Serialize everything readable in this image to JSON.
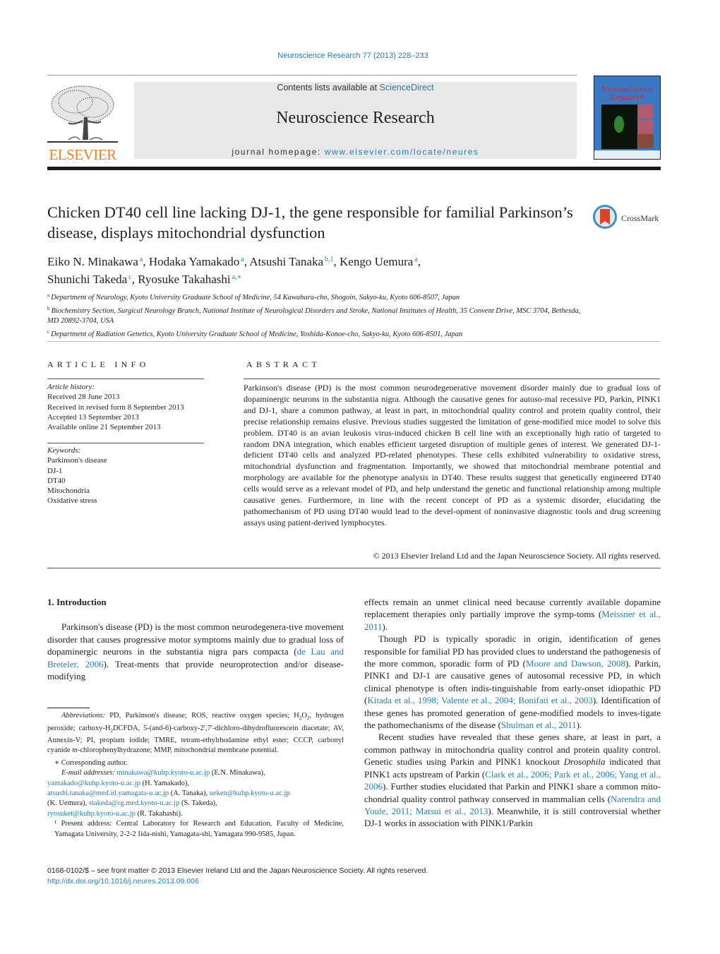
{
  "header": {
    "journal_reference": "Neuroscience Research 77 (2013) 228–233",
    "publisher_logo_text": "ELSEVIER",
    "contents_prefix": "Contents lists available at ",
    "contents_link": "ScienceDirect",
    "journal_name": "Neuroscience Research",
    "homepage_prefix": "journal homepage: ",
    "homepage_link": "www.elsevier.com/locate/neures",
    "cover_title_line1": "Neuroscience",
    "cover_title_line2": "Research",
    "crossmark_label": "CrossMark"
  },
  "article": {
    "title": "Chicken DT40 cell line lacking DJ-1, the gene responsible for familial Parkinson’s disease, displays mitochondrial dysfunction",
    "authors": [
      {
        "name": "Eiko N. Minakawa",
        "marks": "a",
        "sep": ", "
      },
      {
        "name": "Hodaka Yamakado",
        "marks": "a",
        "sep": ", "
      },
      {
        "name": "Atsushi Tanaka",
        "marks": "b,1",
        "sep": ", "
      },
      {
        "name": "Kengo Uemura",
        "marks": "a",
        "sep": ","
      },
      {
        "name": "Shunichi Takeda",
        "marks": "c",
        "sep": ", "
      },
      {
        "name": "Ryosuke Takahashi",
        "marks": "a,∗",
        "sep": ""
      }
    ],
    "affiliations": [
      {
        "mark": "a",
        "text": "Department of Neurology, Kyoto University Graduate School of Medicine, 54 Kawahara-cho, Shogoin, Sakyo-ku, Kyoto 606-8507, Japan"
      },
      {
        "mark": "b",
        "text": "Biochemistry Section, Surgical Neurology Branch, National Institute of Neurological Disorders and Stroke, National Institutes of Health, 35 Convent Drive, MSC 3704, Bethesda, MD 20892-3704, USA"
      },
      {
        "mark": "c",
        "text": "Department of Radiation Genetics, Kyoto University Graduate School of Medicine, Yoshida-Konoe-cho, Sakyo-ku, Kyoto 606-8501, Japan"
      }
    ]
  },
  "article_info": {
    "heading": "ARTICLE INFO",
    "history_label": "Article history:",
    "history": [
      "Received 28 June 2013",
      "Received in revised form 8 September 2013",
      "Accepted 13 September 2013",
      "Available online 21 September 2013"
    ],
    "keywords_label": "Keywords:",
    "keywords": [
      "Parkinson's disease",
      "DJ-1",
      "DT40",
      "Mitochondria",
      "Oxidative stress"
    ]
  },
  "abstract": {
    "heading": "ABSTRACT",
    "text": "Parkinson's disease (PD) is the most common neurodegenerative movement disorder mainly due to gradual loss of dopaminergic neurons in the substantia nigra. Although the causative genes for autoso-mal recessive PD, Parkin, PINK1 and DJ-1, share a common pathway, at least in part, in mitochondrial quality control and protein quality control, their precise relationship remains elusive. Previous studies suggested the limitation of gene-modified mice model to solve this problem. DT40 is an avian leukosis virus-induced chicken B cell line with an exceptionally high ratio of targeted to random DNA integration, which enables efficient targeted disruption of multiple genes of interest. We generated DJ-1-deficient DT40 cells and analyzed PD-related phenotypes. These cells exhibited vulnerability to oxidative stress, mitochondrial dysfunction and fragmentation. Importantly, we showed that mitochondrial membrane potential and morphology are available for the phenotype analysis in DT40. These results suggest that genetically engineered DT40 cells would serve as a relevant model of PD, and help understand the genetic and functional relationship among multiple causative genes. Furthermore, in line with the recent concept of PD as a systemic disorder, elucidating the pathomechanism of PD using DT40 would lead to the devel-opment of noninvasive diagnostic tools and drug screening assays using patient-derived lymphocytes.",
    "copyright": "© 2013 Elsevier Ireland Ltd and the Japan Neuroscience Society. All rights reserved."
  },
  "introduction": {
    "heading": "1.  Introduction",
    "p1_a": "Parkinson's disease (PD) is the most common neurodegenera-tive movement disorder that causes progressive motor symptoms mainly due to gradual loss of dopaminergic neurons in the substantia nigra pars compacta (",
    "p1_cite": "de Lau and Breteler, 2006",
    "p1_b": "). Treat-ments that provide neuroprotection and/or disease-modifying",
    "r1_a": "effects remain an unmet clinical need because currently available dopamine replacement therapies only partially improve the symp-toms (",
    "r1_cite": "Meissner et al., 2011",
    "r1_b": ").",
    "r2_a": "Though PD is typically sporadic in origin, identification of genes responsible for familial PD has provided clues to understand the pathogenesis of the more common, sporadic form of PD (",
    "r2_cite1": "Moore and Dawson, 2008",
    "r2_b": "). Parkin, PINK1 and DJ-1 are causative genes of autosomal recessive PD, in which clinical phenotype is often indis-tinguishable from early-onset idiopathic PD (",
    "r2_cite2": "Kitada et al., 1998; Valente et al., 2004; Bonifati et al., 2003",
    "r2_c": "). Identification of these genes has promoted generation of gene-modified models to inves-tigate the pathomechanisms of the disease (",
    "r2_cite3": "Shulman et al., 2011",
    "r2_d": ").",
    "r3_a": "Recent studies have revealed that these genes share, at least in part, a common pathway in mitochondria quality control and protein quality control. Genetic studies using Parkin and PINK1 knockout ",
    "r3_italic": "Drosophila",
    "r3_b": " indicated that PINK1 acts upstream of Parkin (",
    "r3_cite1": "Clark et al., 2006; Park et al., 2006; Yang et al., 2006",
    "r3_c": "). Further studies elucidated that Parkin and PINK1 share a common mito-chondrial quality control pathway conserved in mammalian cells (",
    "r3_cite2": "Narendra and Youle, 2011; Matsui et al., 2013",
    "r3_d": "). Meanwhile, it is still controversial whether DJ-1 works in association with PINK1/Parkin"
  },
  "footnotes": {
    "abbrev_label": "Abbreviations:",
    "abbrev_a": " PD, Parkinson's disease; ROS, reactive oxygen species; H",
    "abbrev_b": "O",
    "abbrev_c": ", hydrogen peroxide; carboxy-H",
    "abbrev_d": "DCFDA, 5-(and-6)-carboxy-2′,7′-dichloro-dihydrofluorescein diacetate; AV, Annexin-V; PI, propium iodide; TMRE, tetram-ethylrhodamine ethyl ester; CCCP, carbonyl cyanide ",
    "abbrev_italic": "m",
    "abbrev_e": "-chlorophenylhydrazone; MMP, mitochondrial membrane potential.",
    "sub2": "2",
    "corresponding": "∗ Corresponding author.",
    "email_label": "E-mail addresses: ",
    "emails": [
      {
        "address": "minakawa@kuhp.kyoto-u.ac.jp",
        "who": " (E.N. Minakawa),"
      },
      {
        "address": "yamakado@kuhp.kyoto-u.ac.jp",
        "who": " (H. Yamakado),"
      },
      {
        "address": "atsushi.tanaka@med.id.yamagata-u.ac.jp",
        "who": " (A. Tanaka), "
      },
      {
        "address": "ueken@kuhp.kyoto-u.ac.jp",
        "who": ""
      },
      {
        "address": "stakeda@rg.med.kyoto-u.ac.jp",
        "who": " (S. Takeda),"
      },
      {
        "address": "ryosuket@kuhp.kyoto-u.ac.jp",
        "who": " (R. Takahashi)."
      }
    ],
    "uemura_prefix": "(K. Uemura), ",
    "present_address": "¹ Present address: Central Laboratory for Research and Education, Faculty of Medicine, Yamagata University, 2-2-2 Iida-nishi, Yamagata-shi, Yamagata 990-9585, Japan."
  },
  "bottom": {
    "issn_line": "0168-0102/$ – see front matter © 2013 Elsevier Ireland Ltd and the Japan Neuroscience Society. All rights reserved.",
    "doi": "http://dx.doi.org/10.1016/j.neures.2013.09.006"
  }
}
